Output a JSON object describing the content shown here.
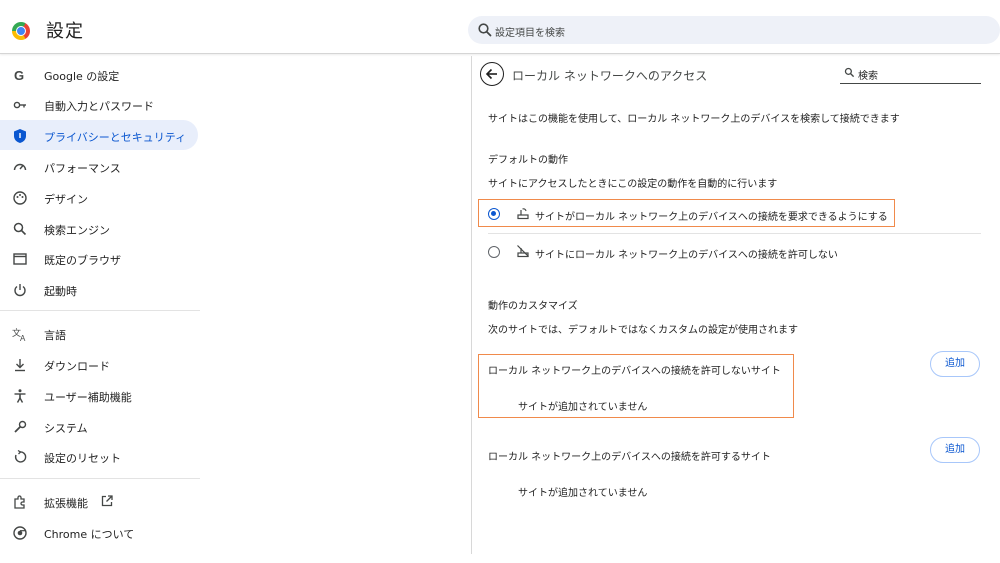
{
  "header": {
    "title": "設定",
    "search_placeholder": "設定項目を検索"
  },
  "sidebar": {
    "items": [
      {
        "label": "Google の設定",
        "icon": "google-icon"
      },
      {
        "label": "自動入力とパスワード",
        "icon": "key-icon"
      },
      {
        "label": "プライバシーとセキュリティ",
        "icon": "shield-icon",
        "active": true
      },
      {
        "label": "パフォーマンス",
        "icon": "speedometer-icon"
      },
      {
        "label": "デザイン",
        "icon": "palette-icon"
      },
      {
        "label": "検索エンジン",
        "icon": "search-icon"
      },
      {
        "label": "既定のブラウザ",
        "icon": "browser-window-icon"
      },
      {
        "label": "起動時",
        "icon": "power-icon"
      },
      {
        "label": "言語",
        "icon": "translate-icon"
      },
      {
        "label": "ダウンロード",
        "icon": "download-icon"
      },
      {
        "label": "ユーザー補助機能",
        "icon": "accessibility-icon"
      },
      {
        "label": "システム",
        "icon": "wrench-icon"
      },
      {
        "label": "設定のリセット",
        "icon": "reset-icon"
      },
      {
        "label": "拡張機能",
        "icon": "puzzle-icon"
      },
      {
        "label": "Chrome について",
        "icon": "chrome-icon"
      }
    ]
  },
  "panel": {
    "title": "ローカル ネットワークへのアクセス",
    "search_label": "検索",
    "description": "サイトはこの機能を使用して、ローカル ネットワーク上のデバイスを検索して接続できます",
    "default_heading": "デフォルトの動作",
    "default_sub": "サイトにアクセスしたときにこの設定の動作を自動的に行います",
    "option_allow": "サイトがローカル ネットワーク上のデバイスへの接続を要求できるようにする",
    "option_block": "サイトにローカル ネットワーク上のデバイスへの接続を許可しない",
    "custom_heading": "動作のカスタマイズ",
    "custom_sub": "次のサイトでは、デフォルトではなくカスタムの設定が使用されます",
    "block_list_title": "ローカル ネットワーク上のデバイスへの接続を許可しないサイト",
    "block_list_empty": "サイトが追加されていません",
    "allow_list_title": "ローカル ネットワーク上のデバイスへの接続を許可するサイト",
    "allow_list_empty": "サイトが追加されていません",
    "add_label": "追加"
  },
  "colors": {
    "accent": "#0b57d0",
    "highlight": "#f08a4b",
    "active_bg": "#e8eefb"
  }
}
